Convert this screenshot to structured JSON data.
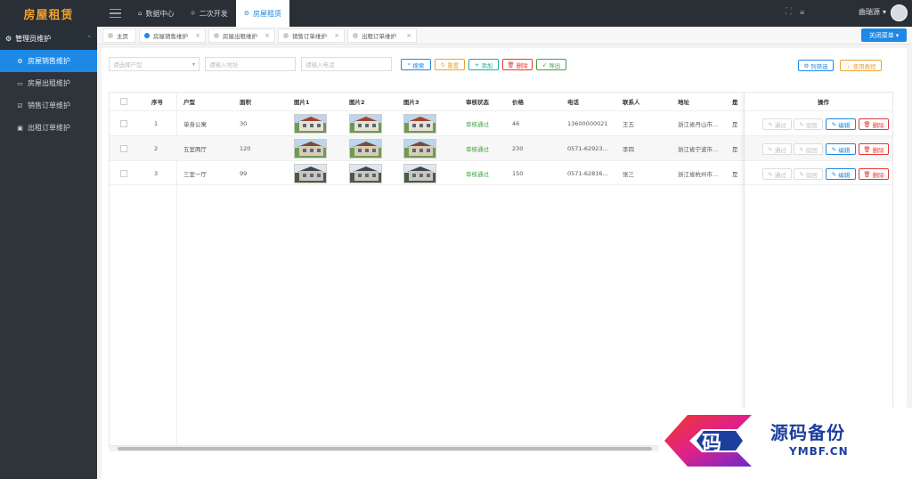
{
  "app": {
    "title": "房屋租赁"
  },
  "topnav": [
    {
      "label": "数据中心",
      "icon": "home-icon"
    },
    {
      "label": "二次开发",
      "icon": "bulb-icon"
    },
    {
      "label": "房屋租赁",
      "icon": "gear-icon",
      "active": true
    }
  ],
  "user": {
    "name": "曲瑞源",
    "caret": "▾"
  },
  "sidebar": {
    "group": "管理员维护",
    "items": [
      {
        "label": "房屋销售维护",
        "active": true
      },
      {
        "label": "房屋出租维护"
      },
      {
        "label": "销售订单维护"
      },
      {
        "label": "出租订单维护"
      }
    ]
  },
  "pagetabs": [
    {
      "label": "主页"
    },
    {
      "label": "房屋销售维护",
      "active": true
    },
    {
      "label": "房屋出租维护"
    },
    {
      "label": "销售订单维护"
    },
    {
      "label": "出租订单维护"
    }
  ],
  "close_menu": "关闭菜单",
  "filters": {
    "type_placeholder": "请选择户型",
    "address_placeholder": "请输入地址",
    "phone_placeholder": "请输入电话"
  },
  "toolbar": {
    "search": "搜索",
    "reset": "重置",
    "add": "添加",
    "delete": "删除",
    "export": "导出",
    "columns": "列筛选",
    "tutorial": "使用教程"
  },
  "table": {
    "headers": {
      "index": "序号",
      "type": "户型",
      "area": "面积",
      "pic1": "图片1",
      "pic2": "图片2",
      "pic3": "图片3",
      "status": "审核状态",
      "price": "价格",
      "phone": "电话",
      "contact": "联系人",
      "address": "地址",
      "extra": "是",
      "ops": "操作"
    },
    "rows": [
      {
        "index": "1",
        "type": "单身公寓",
        "area": "30",
        "status": "审核通过",
        "price": "46",
        "phone": "13600000021",
        "contact": "王五",
        "address": "浙江省丹山市...",
        "extra": "是"
      },
      {
        "index": "2",
        "type": "五室两厅",
        "area": "120",
        "status": "审核通过",
        "price": "230",
        "phone": "0571-62923...",
        "contact": "李四",
        "address": "浙江省宁波市...",
        "extra": "是"
      },
      {
        "index": "3",
        "type": "三室一厅",
        "area": "99",
        "status": "审核通过",
        "price": "150",
        "phone": "0571-62816...",
        "contact": "张三",
        "address": "浙江省杭州市...",
        "extra": "是"
      }
    ],
    "row_actions": {
      "approve": "通过",
      "reject": "驳回",
      "edit": "编辑",
      "delete": "删除"
    }
  },
  "watermark": {
    "cn": "源码备份",
    "en": "YMBF.CN",
    "glyph": "码"
  }
}
